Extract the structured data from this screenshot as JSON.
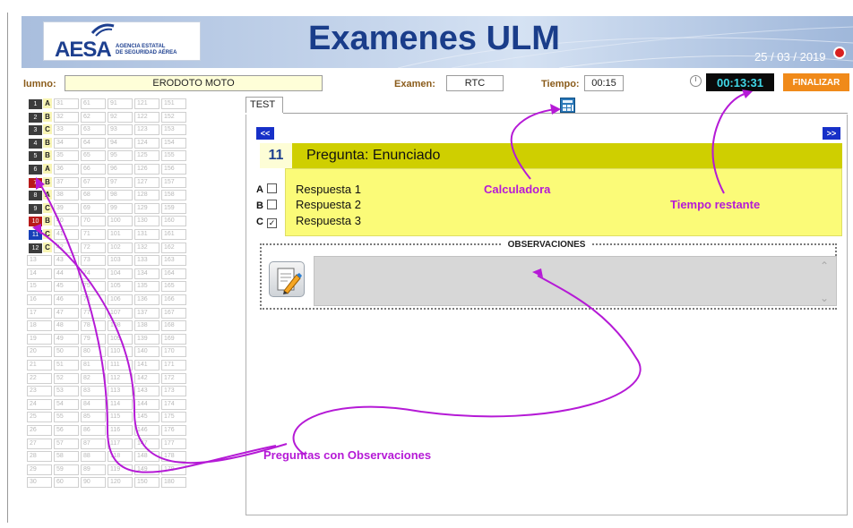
{
  "header": {
    "logo_text": "AESA",
    "logo_sub1": "AGENCIA ESTATAL",
    "logo_sub2": "DE SEGURIDAD AÉREA",
    "title": "Examenes ULM",
    "date": "25 / 03 / 2019"
  },
  "info": {
    "alumno_label": "lumno:",
    "alumno_value": "ERODOTO MOTO",
    "examen_label": "Examen:",
    "examen_value": "RTC",
    "tiempo_label": "Tiempo:",
    "tiempo_value": "00:15",
    "timer_value": "00:13:31",
    "finalizar_label": "FINALIZAR"
  },
  "grid": {
    "answers": [
      {
        "n": "1",
        "l": "A",
        "state": "normal"
      },
      {
        "n": "2",
        "l": "B",
        "state": "normal"
      },
      {
        "n": "3",
        "l": "C",
        "state": "normal"
      },
      {
        "n": "4",
        "l": "B",
        "state": "normal"
      },
      {
        "n": "5",
        "l": "B",
        "state": "normal"
      },
      {
        "n": "6",
        "l": "A",
        "state": "normal"
      },
      {
        "n": "7",
        "l": "B",
        "state": "obs"
      },
      {
        "n": "8",
        "l": "A",
        "state": "normal"
      },
      {
        "n": "9",
        "l": "C",
        "state": "normal"
      },
      {
        "n": "10",
        "l": "B",
        "state": "obs"
      },
      {
        "n": "11",
        "l": "C",
        "state": "cur"
      },
      {
        "n": "12",
        "l": "C",
        "state": "normal"
      }
    ]
  },
  "tab": {
    "label": "TEST"
  },
  "nav": {
    "prev": "<<",
    "next": ">>"
  },
  "question": {
    "number": "11",
    "text": "Pregunta: Enunciado",
    "options": [
      {
        "letter": "A",
        "label": "Respuesta 1",
        "checked": false
      },
      {
        "letter": "B",
        "label": "Respuesta 2",
        "checked": false
      },
      {
        "letter": "C",
        "label": "Respuesta 3",
        "checked": true
      }
    ]
  },
  "observations": {
    "title": "OBSERVACIONES"
  },
  "annotations": {
    "calculadora": "Calculadora",
    "tiempo_restante": "Tiempo restante",
    "preguntas_obs": "Preguntas con Observaciones"
  },
  "colors": {
    "accent": "#1d3f8f",
    "annotation": "#b51ad6",
    "finalizar": "#f08a1a",
    "question_bar": "#cfcf00",
    "answers_bg": "#fbfb78"
  }
}
